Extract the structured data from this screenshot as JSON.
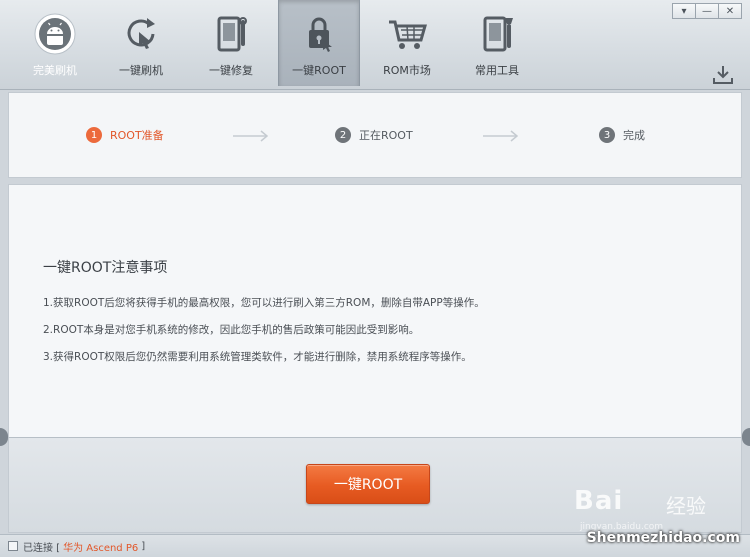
{
  "toolbar": {
    "items": [
      {
        "label": "完美刷机",
        "icon": "android-icon"
      },
      {
        "label": "一键刷机",
        "icon": "tap-refresh-icon"
      },
      {
        "label": "一键修复",
        "icon": "phone-repair-icon"
      },
      {
        "label": "一键ROOT",
        "icon": "phone-lock-icon",
        "active": true
      },
      {
        "label": "ROM市场",
        "icon": "shopping-cart-icon"
      },
      {
        "label": "常用工具",
        "icon": "phone-tools-icon"
      }
    ],
    "window_controls": {
      "menu": "▾",
      "minimize": "—",
      "close": "✕"
    }
  },
  "steps": [
    {
      "num": "1",
      "label": "ROOT准备",
      "active": true
    },
    {
      "num": "2",
      "label": "正在ROOT"
    },
    {
      "num": "3",
      "label": "完成"
    }
  ],
  "notes": {
    "title": "一键ROOT注意事项",
    "items": [
      "1.获取ROOT后您将获得手机的最高权限，您可以进行刷入第三方ROM，删除自带APP等操作。",
      "2.ROOT本身是对您手机系统的修改，因此您手机的售后政策可能因此受到影响。",
      "3.获得ROOT权限后您仍然需要利用系统管理类软件，才能进行删除，禁用系统程序等操作。"
    ]
  },
  "action": {
    "root_button": "一键ROOT"
  },
  "status": {
    "prefix": "已连接 [",
    "device": "华为 Ascend P6",
    "suffix": "]"
  },
  "watermark": {
    "main": "Bai",
    "cn": "经验",
    "url": "jingyan.baidu.com",
    "site": "Shenmezhidao.com"
  },
  "colors": {
    "accent": "#e75b22",
    "step_active": "#ec6a3c"
  }
}
